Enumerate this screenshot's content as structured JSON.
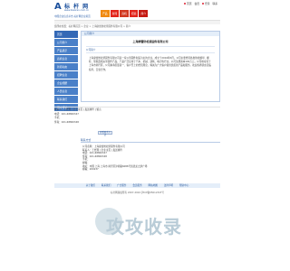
{
  "header": {
    "logo_glyph": "A",
    "logo_name": "标 杆 网",
    "logo_url": "www.biaoran.com.cn",
    "slogan": "中国企业信息平台·标杆网企业黄页",
    "toplinks": [
      "首页",
      "会员",
      "登录",
      "联系"
    ],
    "nav_tabs": [
      "产品",
      "新闻",
      "商机",
      "招商",
      "简介"
    ]
  },
  "breadcrumb": "您所在位置：标杆网首页 > 企业 > 上海摩雷防松紧固件有限公司 > 简介",
  "sidebar": {
    "items": [
      "首页",
      "公司简介",
      "产品展示",
      "商机信息",
      "新闻动态",
      "招聘信息",
      "企业相册",
      "人员信息",
      "联系我们",
      "留言评论"
    ]
  },
  "main": {
    "header_label": "公司简介",
    "company_name": "上海摩雷防松紧固件有限公司",
    "intro_label": "公司简介",
    "intro_text": "上海摩雷防松紧固件有限公司是一家以紧固件制造为主的企业，成立于2004年5月，公司主要经营各类防松螺母、螺栓、垫圈及相关紧固件产品，产品广泛应用于汽车、机械、建筑、电力等行业。公司注册资本100万元，公司地址位于上海市闵行区，公司秉承质量第一、客户至上的经营理念，竭诚为广大客户提供优质的产品和服务。欢迎各界朋友莅临指导，洽谈合作。"
  },
  "contact_left": {
    "line1": "联系人：王经理 | 企业主页 | 发送邮件 | 留言",
    "line2": "电话：021-68800347",
    "line3": "手机：",
    "line4": "传真：021-68800348",
    "more_button": "查看联系方式"
  },
  "contact_panel": {
    "header": "联系方式",
    "rows": [
      "公司名称：上海摩雷防松紧固件有限公司",
      "联系人：王经理 | 企业主页 | 发送邮件",
      "电话：021-68800347",
      "传真：021-68800348",
      "手机：",
      "邮箱：",
      "地址：中国 上海 上海市 闵行区沪闵路6088号凯德龙之梦广场",
      "邮编：200237"
    ]
  },
  "footer": {
    "links": [
      "关于我们",
      "联系我们",
      "广告服务",
      "会员服务",
      "网站地图",
      "法律声明",
      "帮助中心"
    ],
    "copyright": "标杆网版权所有 2007-2024 沪ICP备05012347号"
  },
  "watermark": {
    "text": "攻攻收录"
  },
  "colors": {
    "brand_blue": "#1a4f9c",
    "sidebar_blue": "#4a80c8",
    "nav_orange": "#f08a10",
    "nav_red": "#e2231a",
    "watermark_grey": "#b9ccd7"
  }
}
